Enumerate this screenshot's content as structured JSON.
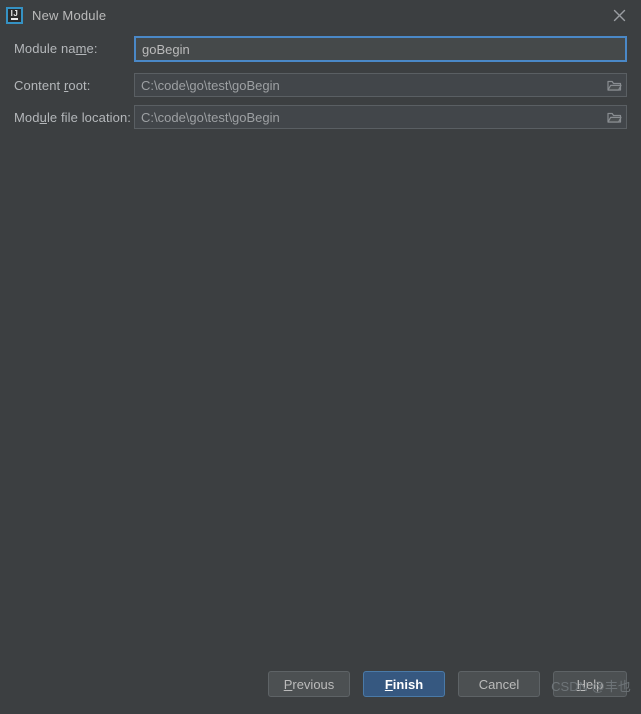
{
  "window": {
    "title": "New Module",
    "app_icon": "intellij-idea-icon",
    "app_icon_text": "IJ",
    "close_icon": "close-icon"
  },
  "form": {
    "rows": [
      {
        "label_before": "Module na",
        "label_mnemonic": "m",
        "label_after": "e:",
        "value": "goBegin",
        "placeholder": "",
        "focused": true,
        "has_browse": false
      },
      {
        "label_before": "Content ",
        "label_mnemonic": "r",
        "label_after": "oot:",
        "value": "C:\\code\\go\\test\\goBegin",
        "placeholder": "",
        "focused": false,
        "has_browse": true,
        "browse_icon": "folder-icon"
      },
      {
        "label_before": "Mod",
        "label_mnemonic": "u",
        "label_after": "le file location:",
        "value": "C:\\code\\go\\test\\goBegin",
        "placeholder": "",
        "focused": false,
        "has_browse": true,
        "browse_icon": "folder-icon"
      }
    ]
  },
  "buttons": {
    "previous": {
      "before": "",
      "mnemonic": "P",
      "after": "revious"
    },
    "finish": {
      "before": "",
      "mnemonic": "F",
      "after": "inish"
    },
    "cancel": {
      "before": "Cancel",
      "mnemonic": "",
      "after": ""
    },
    "help": {
      "before": "",
      "mnemonic": "H",
      "after": "elp"
    }
  },
  "watermark": {
    "text": "CSDN @丰也"
  },
  "colors": {
    "dialog_background": "#3c3f41",
    "focus_border": "#4a88c7",
    "default_button": "#365880",
    "text": "#bbbbbb"
  }
}
